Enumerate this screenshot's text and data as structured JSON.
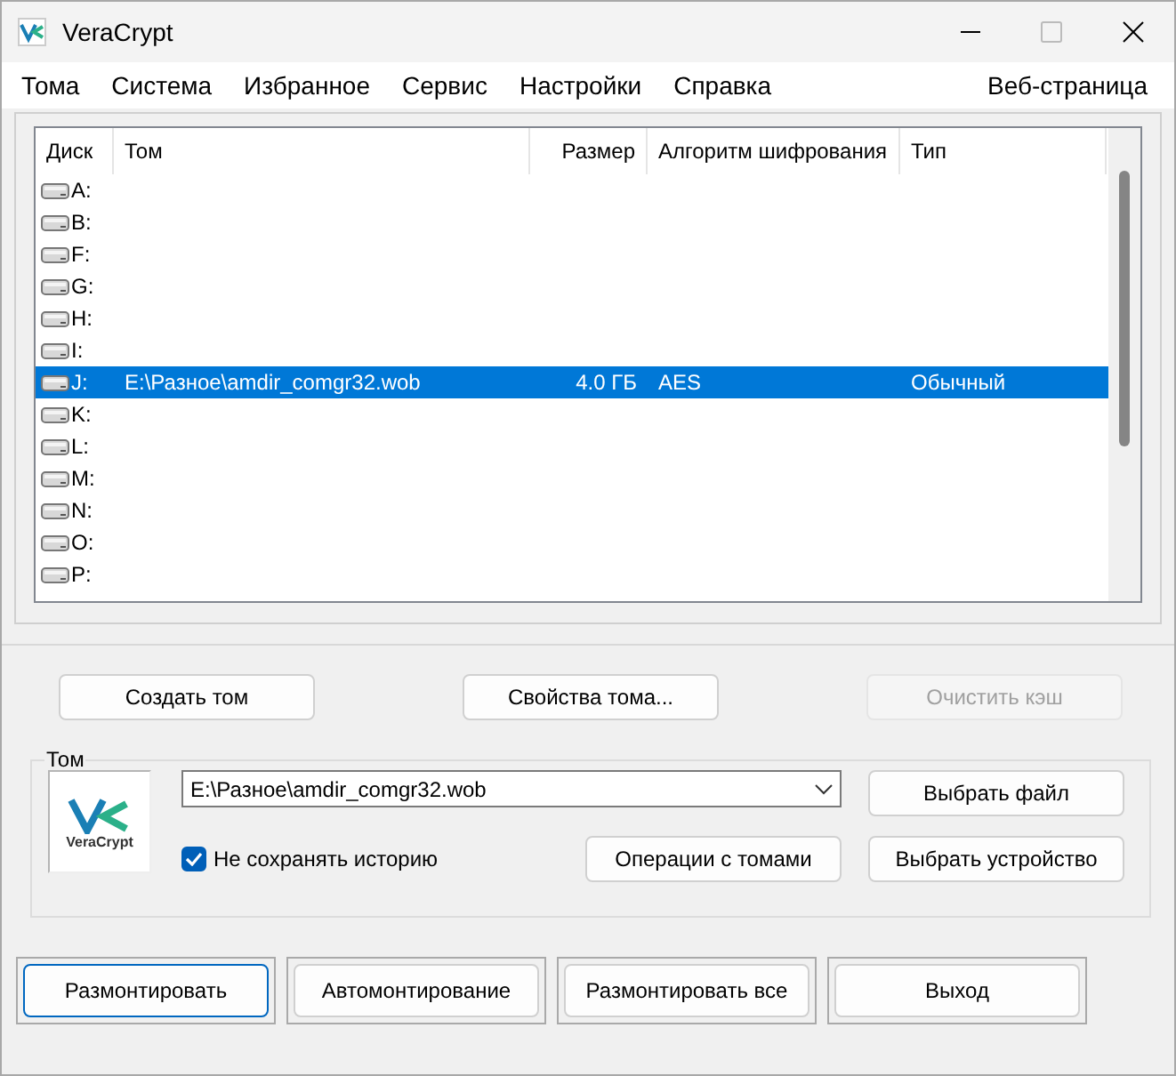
{
  "window": {
    "title": "VeraCrypt"
  },
  "menu": [
    "Тома",
    "Система",
    "Избранное",
    "Сервис",
    "Настройки",
    "Справка"
  ],
  "menu_right": "Веб-страница",
  "table": {
    "columns": [
      "Диск",
      "Том",
      "Размер",
      "Алгоритм шифрования",
      "Тип"
    ],
    "rows": [
      {
        "drive": "A:",
        "volume": "",
        "size": "",
        "algorithm": "",
        "type": "",
        "selected": false
      },
      {
        "drive": "B:",
        "volume": "",
        "size": "",
        "algorithm": "",
        "type": "",
        "selected": false
      },
      {
        "drive": "F:",
        "volume": "",
        "size": "",
        "algorithm": "",
        "type": "",
        "selected": false
      },
      {
        "drive": "G:",
        "volume": "",
        "size": "",
        "algorithm": "",
        "type": "",
        "selected": false
      },
      {
        "drive": "H:",
        "volume": "",
        "size": "",
        "algorithm": "",
        "type": "",
        "selected": false
      },
      {
        "drive": "I:",
        "volume": "",
        "size": "",
        "algorithm": "",
        "type": "",
        "selected": false
      },
      {
        "drive": "J:",
        "volume": "E:\\Разное\\amdir_comgr32.wob",
        "size": "4.0 ГБ",
        "algorithm": "AES",
        "type": "Обычный",
        "selected": true
      },
      {
        "drive": "K:",
        "volume": "",
        "size": "",
        "algorithm": "",
        "type": "",
        "selected": false
      },
      {
        "drive": "L:",
        "volume": "",
        "size": "",
        "algorithm": "",
        "type": "",
        "selected": false
      },
      {
        "drive": "M:",
        "volume": "",
        "size": "",
        "algorithm": "",
        "type": "",
        "selected": false
      },
      {
        "drive": "N:",
        "volume": "",
        "size": "",
        "algorithm": "",
        "type": "",
        "selected": false
      },
      {
        "drive": "O:",
        "volume": "",
        "size": "",
        "algorithm": "",
        "type": "",
        "selected": false
      },
      {
        "drive": "P:",
        "volume": "",
        "size": "",
        "algorithm": "",
        "type": "",
        "selected": false
      }
    ]
  },
  "top_buttons": [
    {
      "label": "Создать том",
      "disabled": false
    },
    {
      "label": "Свойства тома...",
      "disabled": false
    },
    {
      "label": "Очистить кэш",
      "disabled": true
    }
  ],
  "volume_group": {
    "title": "Том",
    "logo_text": "VeraCrypt",
    "path": "E:\\Разное\\amdir_comgr32.wob",
    "no_history": {
      "label": "Не сохранять историю",
      "checked": true
    },
    "buttons": [
      "Выбрать файл",
      "Операции с томами",
      "Выбрать устройство"
    ]
  },
  "bottom_buttons": [
    {
      "label": "Размонтировать",
      "focused": true
    },
    {
      "label": "Автомонтирование",
      "focused": false
    },
    {
      "label": "Размонтировать все",
      "focused": false
    },
    {
      "label": "Выход",
      "focused": false
    }
  ]
}
